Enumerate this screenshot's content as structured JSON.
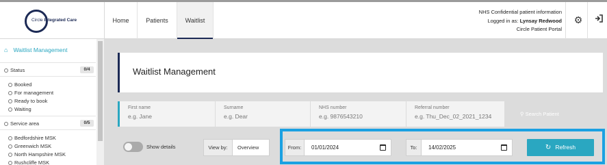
{
  "brand": {
    "logo_circle": "Circle",
    "logo_integrated": "Integrated Care"
  },
  "nav": {
    "tabs": [
      "Home",
      "Patients",
      "Waitlist"
    ],
    "active": "Waitlist"
  },
  "user": {
    "line1": "NHS Confidential patient information",
    "logged_label": "Logged in as:",
    "name": "Lynsay Redwood",
    "portal": "Circle Patient Portal"
  },
  "header_icons": {
    "settings": "gear-icon",
    "logout": "sign-out-icon"
  },
  "sidebar": {
    "title": "Waitlist Management",
    "groups": [
      {
        "label": "Status",
        "count": "0/4",
        "items": [
          "Booked",
          "For management",
          "Ready to book",
          "Waiting"
        ]
      },
      {
        "label": "Service area",
        "count": "0/5",
        "items": [
          "Bedfordshire MSK",
          "Greenwich MSK",
          "North Hampshire MSK",
          "Rushcliffe MSK"
        ]
      }
    ]
  },
  "main": {
    "title": "Waitlist Management",
    "search": {
      "first_name_label": "First name",
      "first_name_placeholder": "e.g. Jane",
      "surname_label": "Surname",
      "surname_placeholder": "e.g. Dear",
      "nhs_label": "NHS number",
      "nhs_placeholder": "e.g. 9876543210",
      "referral_label": "Referral number",
      "referral_placeholder": "e.g. Thu_Dec_02_2021_1234",
      "button": "Search Patient"
    },
    "controls": {
      "show_details": "Show details",
      "view_by_label": "View by:",
      "view_by_value": "Overview",
      "from_label": "From:",
      "from_value": "01/01/2024",
      "to_label": "To:",
      "to_value": "14/02/2025",
      "refresh": "Refresh"
    }
  },
  "colors": {
    "accent": "#2aa7c1",
    "navy": "#1c2a55",
    "highlight": "#1ba1e2"
  }
}
